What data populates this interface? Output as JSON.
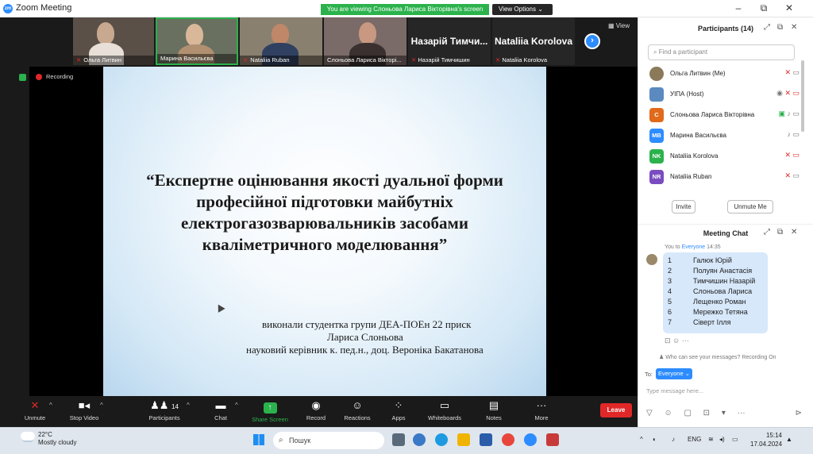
{
  "window": {
    "title": "Zoom Meeting",
    "banner": "You are viewing Слоньова Лариса Вікторівна's screen",
    "view_options": "View Options",
    "minimize": "–",
    "maximize": "⧉",
    "close": "✕"
  },
  "gallery": {
    "tiles": [
      {
        "label": "Ольга Литвин",
        "muted": true
      },
      {
        "label": "Марина Васильєва",
        "muted": false
      },
      {
        "label": "Nataliia Ruban",
        "muted": true
      },
      {
        "label": "Слоньова Лариса Вікторі...",
        "muted": false
      },
      {
        "label": "Назарій Тимчишин",
        "big": "Назарій Тимчи...",
        "muted": true
      },
      {
        "label": "Nataliia Korolova",
        "big": "Nataliia Korolova",
        "muted": true
      }
    ],
    "next_icon": "›",
    "view_label": "View"
  },
  "recording_label": "Recording",
  "slide": {
    "title": "“Експертне оцінювання якості дуальної форми професійної підготовки майбутніх електрогазозварювальників засобами кваліметричного моделювання”",
    "line1": "виконали студентка групи ДЕА-ПОЕн 22 приск",
    "line2": "Лариса Слоньова",
    "line3": "науковий керівник  к. пед.н., доц. Вероніка Бакатанова"
  },
  "toolbar": {
    "unmute": "Unmute",
    "stop_video": "Stop Video",
    "participants": "Participants",
    "participants_count": "14",
    "chat": "Chat",
    "share_screen": "Share Screen",
    "record": "Record",
    "reactions": "Reactions",
    "apps": "Apps",
    "whiteboards": "Whiteboards",
    "notes": "Notes",
    "more": "More",
    "leave": "Leave"
  },
  "participants_panel": {
    "title": "Participants (14)",
    "search_placeholder": "Find a participant",
    "people": [
      {
        "name": "Ольга Литвин (Me)",
        "initials": "",
        "color": "#8a7a5a",
        "status": "✕ ▭"
      },
      {
        "name": "УІПА (Host)",
        "initials": "",
        "color": "#5a8ac0",
        "status": "◉ ✕ ▭"
      },
      {
        "name": "Слоньова Лариса Вікторівна",
        "initials": "С",
        "color": "#e06a1a",
        "status": "▣ ♪ ▭"
      },
      {
        "name": "Марина Васильєва",
        "initials": "МВ",
        "color": "#2d8cff",
        "status": "♪ ▭"
      },
      {
        "name": "Nataliia Korolova",
        "initials": "NK",
        "color": "#2bb24c",
        "status": "✕ ▭"
      },
      {
        "name": "Nataliia Ruban",
        "initials": "NR",
        "color": "#7a4cc0",
        "status": "✕ ▭"
      }
    ],
    "invite": "Invite",
    "unmute_me": "Unmute Me"
  },
  "chat_panel": {
    "title": "Meeting Chat",
    "meta_prefix": "You to",
    "meta_to": "Everyone",
    "meta_time": "14:35",
    "lines": [
      {
        "n": "1",
        "name": "Галюк Юрій"
      },
      {
        "n": "2",
        "name": "Полуян Анастасія"
      },
      {
        "n": "3",
        "name": "Тимчишин Назарій"
      },
      {
        "n": "4",
        "name": "Слоньова Лариса"
      },
      {
        "n": "5",
        "name": "Лещенко Роман"
      },
      {
        "n": "6",
        "name": "Мережко Тетяна"
      },
      {
        "n": "7",
        "name": "Сіверт Ілля"
      }
    ],
    "actions": "⊡ ☺ ···",
    "who_can_see": "Who can see your messages? Recording On",
    "to_label": "To:",
    "to_value": "Everyone",
    "placeholder": "Type message here...",
    "tools": "▽ ☺ ▢ ⊡ ▾ ···",
    "send": "⊳"
  },
  "taskbar": {
    "temp": "22°C",
    "weather": "Mostly cloudy",
    "search": "Пошук",
    "lang": "ENG",
    "time": "15:14",
    "date": "17.04.2024"
  }
}
